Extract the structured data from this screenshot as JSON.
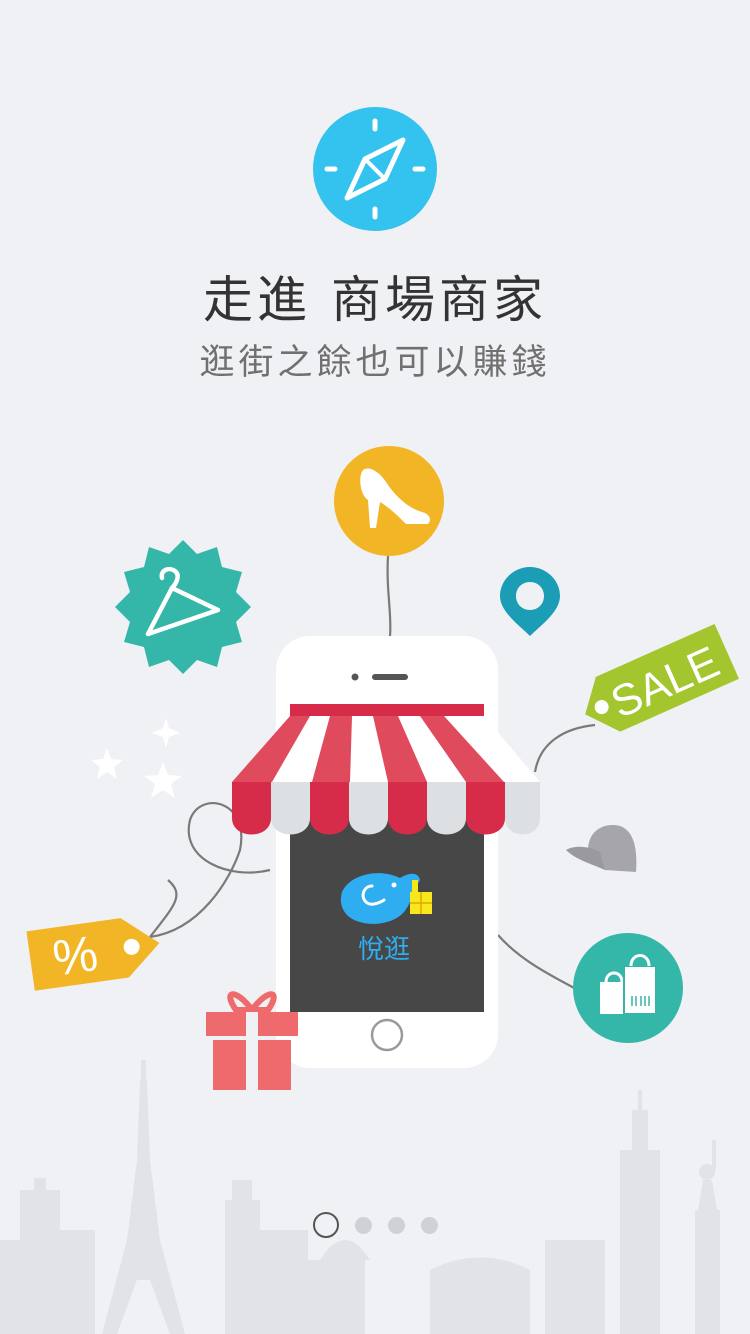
{
  "header": {
    "title": "走進 商場商家",
    "subtitle": "逛街之餘也可以賺錢"
  },
  "illustration": {
    "sale_tag_text": "SALE",
    "percent_tag_text": "%",
    "app_logo_text": "悅逛"
  },
  "pager": {
    "total_pages": 4,
    "active_page": 1
  },
  "colors": {
    "background": "#f0f1f4",
    "compass": "#34c2ee",
    "yellow": "#f2b526",
    "teal": "#34b7a9",
    "pin": "#1b9db5",
    "green": "#a3c52e",
    "awning_red": "#e04a5d",
    "awning_dark": "#d62c4a",
    "gift": "#ef6a6c",
    "screen": "#474747",
    "logo_blue": "#2eaef0"
  }
}
